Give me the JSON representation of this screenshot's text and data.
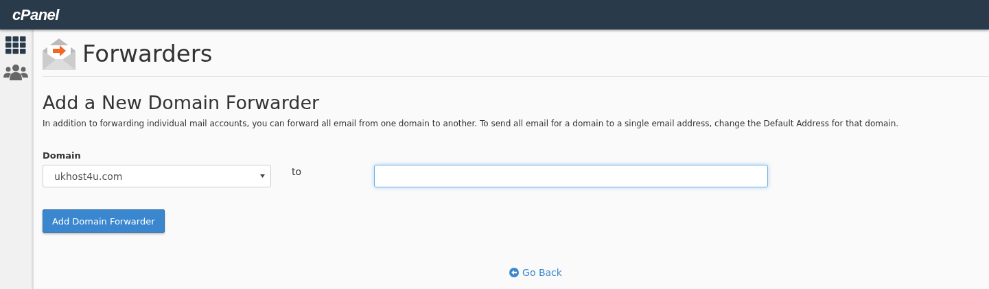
{
  "header": {
    "logo": "cPanel"
  },
  "page": {
    "title": "Forwarders"
  },
  "section": {
    "heading": "Add a New Domain Forwarder",
    "description": "In addition to forwarding individual mail accounts, you can forward all email from one domain to another. To send all email for a domain to a single email address, change the Default Address for that domain."
  },
  "form": {
    "domain_label": "Domain",
    "domain_value": "ukhost4u.com",
    "to_label": "to",
    "to_focused": true,
    "submit": "Add Domain Forwarder"
  },
  "footer": {
    "link": "Go Back"
  }
}
